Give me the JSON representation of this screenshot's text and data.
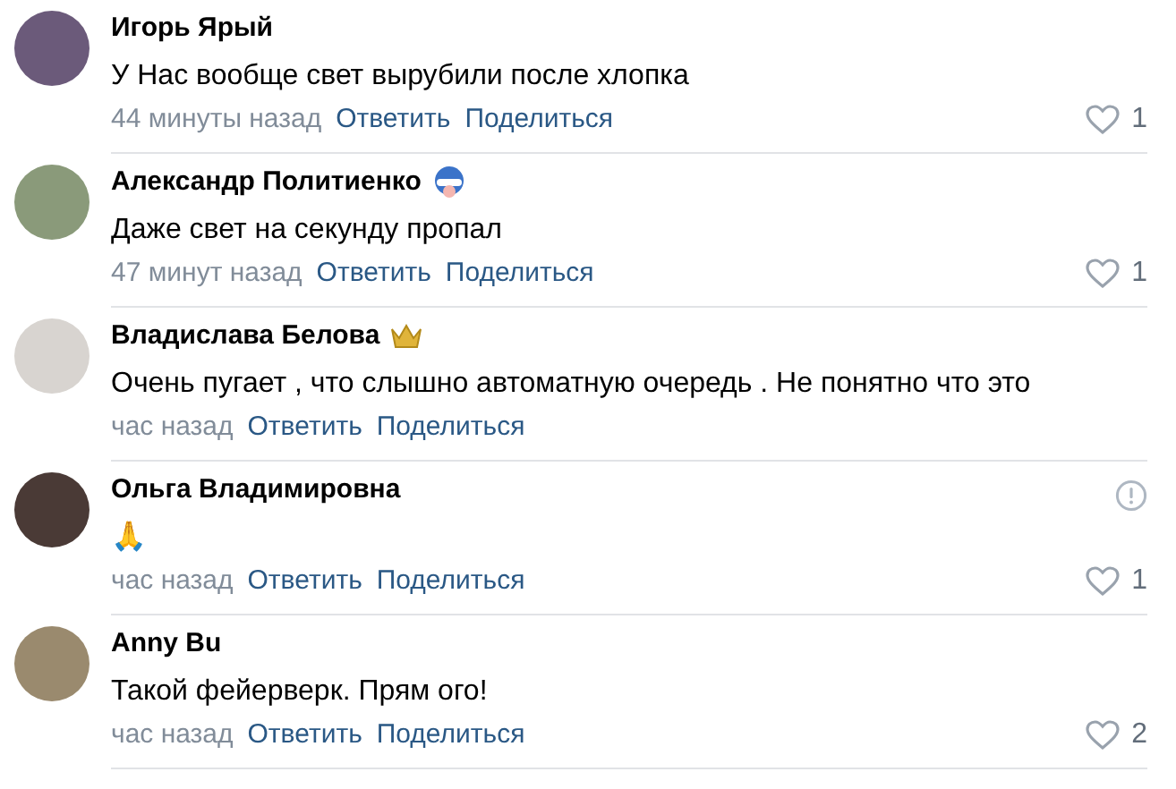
{
  "comments": [
    {
      "author": "Игорь Ярый",
      "kind": "plain",
      "text": "У Нас вообще свет вырубили после хлопка",
      "time": "44 минуты назад",
      "reply": "Ответить",
      "share": "Поделиться",
      "likes": "1",
      "alert": false
    },
    {
      "author": "Александр Политиенко",
      "kind": "helmet",
      "text": "Даже свет на секунду пропал",
      "time": "47 минут назад",
      "reply": "Ответить",
      "share": "Поделиться",
      "likes": "1",
      "alert": false
    },
    {
      "author": "Владислава Белова",
      "kind": "crown",
      "text": "Очень пугает , что слышно автоматную очередь . Не понятно что это",
      "time": "час назад",
      "reply": "Ответить",
      "share": "Поделиться",
      "alert": false
    },
    {
      "author": "Ольга Владимировна",
      "kind": "plain",
      "text": "🙏",
      "time": "час назад",
      "reply": "Ответить",
      "share": "Поделиться",
      "likes": "1",
      "alert": true
    },
    {
      "author": "Anny Bu",
      "kind": "plain",
      "text": "Такой фейерверк. Прям ого!",
      "time": "час назад",
      "reply": "Ответить",
      "share": "Поделиться",
      "likes": "2",
      "alert": false
    }
  ]
}
